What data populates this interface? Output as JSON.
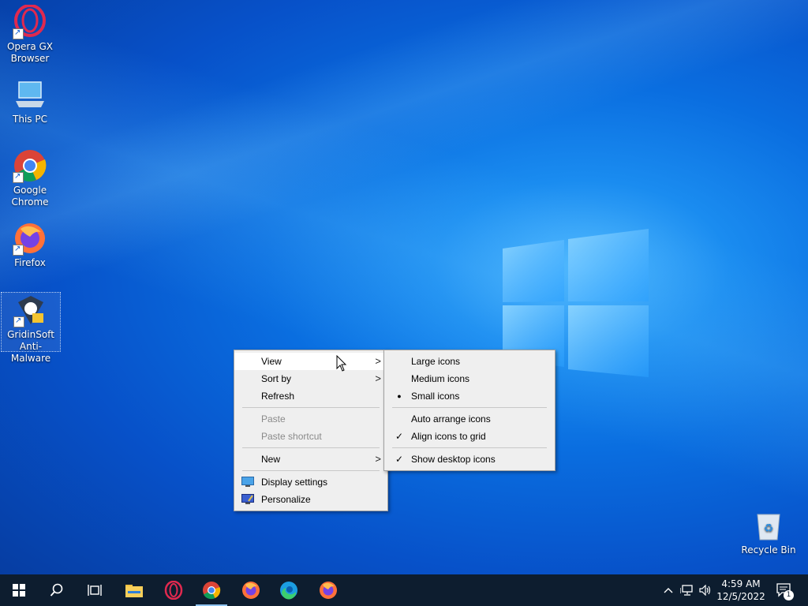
{
  "desktop": {
    "icons": [
      {
        "label_line1": "Opera GX",
        "label_line2": "Browser",
        "icon": "opera-gx-icon"
      },
      {
        "label_line1": "This PC",
        "label_line2": "",
        "icon": "this-pc-icon"
      },
      {
        "label_line1": "Google",
        "label_line2": "Chrome",
        "icon": "chrome-icon"
      },
      {
        "label_line1": "Firefox",
        "label_line2": "",
        "icon": "firefox-icon"
      },
      {
        "label_line1": "GridinSoft",
        "label_line2": "Anti-Malware",
        "icon": "gridinsoft-icon"
      },
      {
        "label_line1": "Recycle Bin",
        "label_line2": "",
        "icon": "recycle-bin-icon"
      }
    ]
  },
  "context_menu": {
    "view": "View",
    "sort_by": "Sort by",
    "refresh": "Refresh",
    "paste": "Paste",
    "paste_shortcut": "Paste shortcut",
    "new": "New",
    "display_settings": "Display settings",
    "personalize": "Personalize"
  },
  "view_submenu": {
    "large_icons": "Large icons",
    "medium_icons": "Medium icons",
    "small_icons": "Small icons",
    "auto_arrange": "Auto arrange icons",
    "align_to_grid": "Align icons to grid",
    "show_desktop_icons": "Show desktop icons",
    "selected_size": "Small icons",
    "bullet_glyph": "●",
    "check_glyph": "✓"
  },
  "taskbar": {
    "apps": [
      "start-icon",
      "search-icon",
      "task-view-icon",
      "file-explorer-icon",
      "opera-icon",
      "chrome-icon",
      "firefox-icon",
      "edge-icon",
      "firefox-icon"
    ],
    "clock_time": "4:59 AM",
    "clock_date": "12/5/2022",
    "notification_count": "1"
  },
  "colors": {
    "taskbar": "#0d1d2f",
    "menu_bg": "#efefef",
    "accent": "#0a6ee0"
  }
}
